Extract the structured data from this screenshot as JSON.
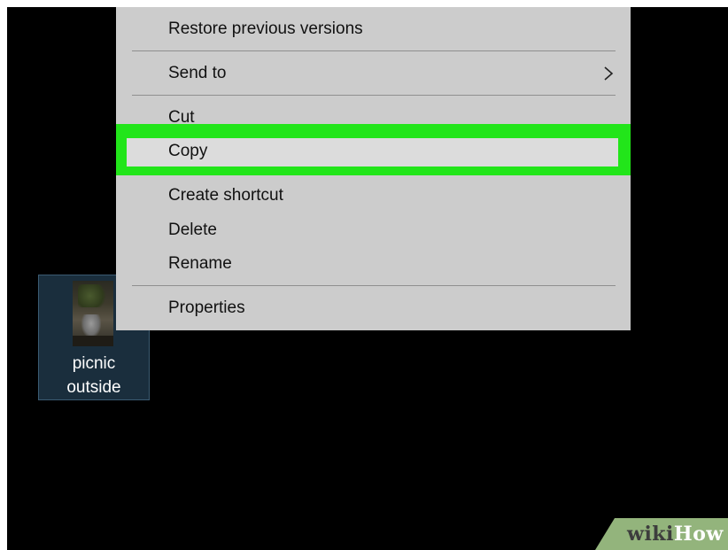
{
  "desktop": {
    "background_color": "#000000",
    "icon": {
      "label_line1": "picnic",
      "label_line2": "outside",
      "icon_name": "image-file-icon"
    }
  },
  "context_menu": {
    "items": [
      {
        "label": "Restore previous versions"
      },
      {
        "label": "Send to",
        "has_submenu": true,
        "submenu_icon": "chevron-right-icon"
      },
      {
        "label": "Cut"
      },
      {
        "label": "Copy",
        "highlighted": true
      },
      {
        "label": "Create shortcut"
      },
      {
        "label": "Delete"
      },
      {
        "label": "Rename"
      },
      {
        "label": "Properties"
      }
    ],
    "highlight_color": "#22e51a"
  },
  "watermark": {
    "part1": "wiki",
    "part2": "How"
  }
}
